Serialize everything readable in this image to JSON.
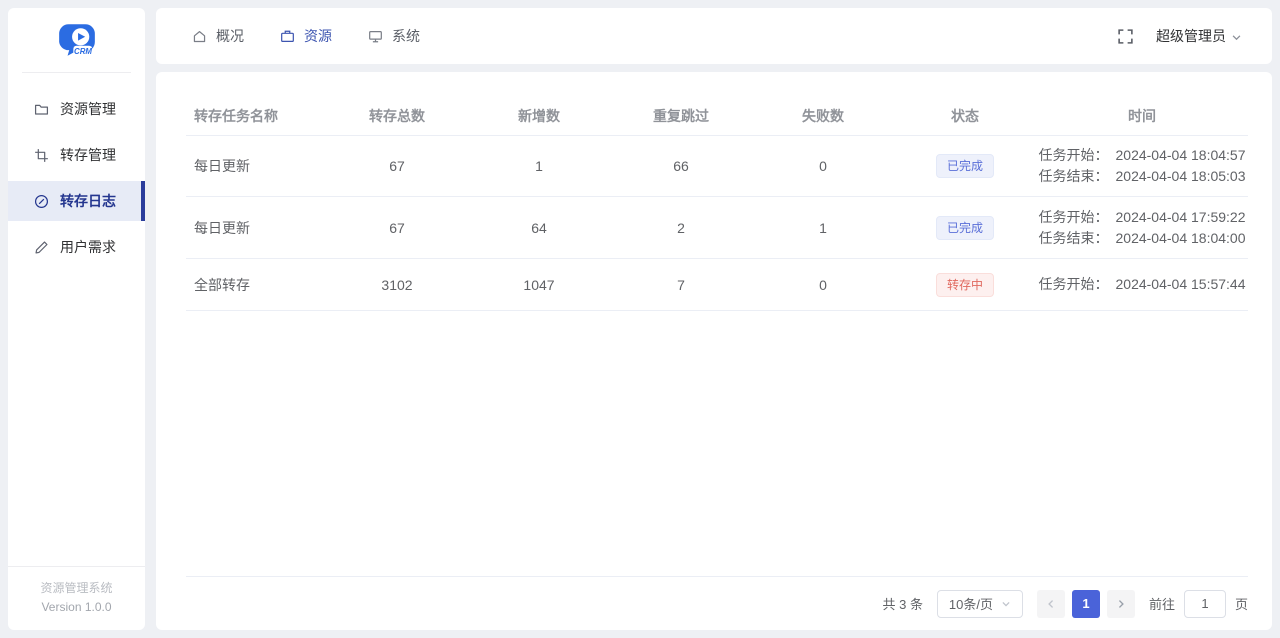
{
  "app": {
    "title": "资源管理系统",
    "version": "Version 1.0.0",
    "logo_text": "CRM"
  },
  "sidebar": {
    "items": [
      {
        "label": "资源管理",
        "icon": "folder-icon"
      },
      {
        "label": "转存管理",
        "icon": "crop-icon"
      },
      {
        "label": "转存日志",
        "icon": "compass-icon",
        "active": true
      },
      {
        "label": "用户需求",
        "icon": "pen-icon"
      }
    ]
  },
  "topbar": {
    "tabs": [
      {
        "label": "概况",
        "icon": "home-icon"
      },
      {
        "label": "资源",
        "icon": "briefcase-icon",
        "active": true
      },
      {
        "label": "系统",
        "icon": "monitor-icon"
      }
    ],
    "fullscreen_icon": "fullscreen-icon",
    "user_label": "超级管理员"
  },
  "table": {
    "columns": [
      "转存任务名称",
      "转存总数",
      "新增数",
      "重复跳过",
      "失败数",
      "状态",
      "时间"
    ],
    "rows": [
      {
        "name": "每日更新",
        "total": "67",
        "added": "1",
        "skipped": "66",
        "failed": "0",
        "status": "已完成",
        "status_type": "success",
        "times": [
          {
            "label": "任务开始：",
            "value": "2024-04-04 18:04:57"
          },
          {
            "label": "任务结束：",
            "value": "2024-04-04 18:05:03"
          }
        ]
      },
      {
        "name": "每日更新",
        "total": "67",
        "added": "64",
        "skipped": "2",
        "failed": "1",
        "status": "已完成",
        "status_type": "success",
        "times": [
          {
            "label": "任务开始：",
            "value": "2024-04-04 17:59:22"
          },
          {
            "label": "任务结束：",
            "value": "2024-04-04 18:04:00"
          }
        ]
      },
      {
        "name": "全部转存",
        "total": "3102",
        "added": "1047",
        "skipped": "7",
        "failed": "0",
        "status": "转存中",
        "status_type": "running",
        "times": [
          {
            "label": "任务开始：",
            "value": "2024-04-04 15:57:44"
          }
        ]
      }
    ]
  },
  "pagination": {
    "total_text": "共 3 条",
    "page_size": "10条/页",
    "prev_icon": "chevron-left-icon",
    "next_icon": "chevron-right-icon",
    "current_page": "1",
    "goto_label": "前往",
    "goto_value": "1",
    "goto_unit": "页"
  },
  "colors": {
    "accent_tab": "#3d55b0",
    "sidebar_active": "#2b3d9b",
    "badge_success_text": "#5a6fd8",
    "badge_success_bg": "#eef1fb",
    "badge_running_text": "#e0685e",
    "badge_running_bg": "#fdf0ef",
    "pager_active_bg": "#4a63d9",
    "logo_blue": "#2b6ce2"
  }
}
